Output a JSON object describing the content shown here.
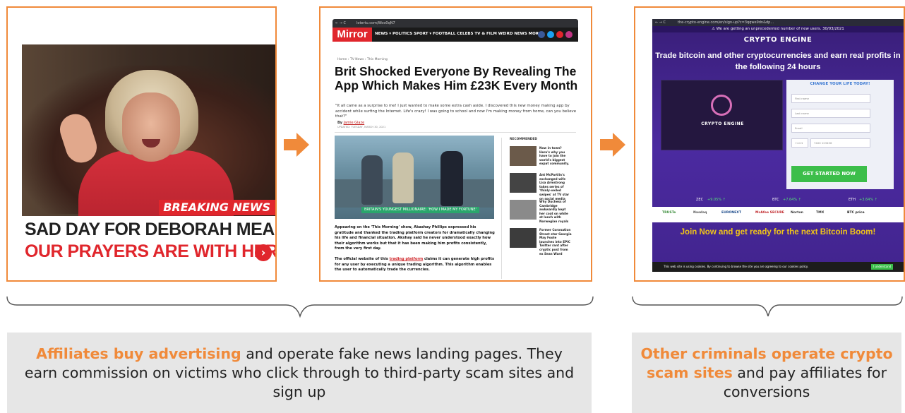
{
  "panel1": {
    "breaking": "BREAKING NEWS",
    "headline1": "SAD DAY FOR DEBORAH MEADEN",
    "headline2": "OUR PRAYERS ARE WITH HER"
  },
  "panel2": {
    "url": "lotertu.com/Woo0qN7",
    "logo": "Mirror",
    "nav": "NEWS ▾  POLITICS  SPORT ▾  FOOTBALL  CELEBS  TV & FILM  WEIRD NEWS  MORE ▾",
    "breadcrumb": "Home  ›  TV News  ›  This Morning",
    "headline": "Brit Shocked Everyone By Revealing The App Which Makes Him £23K Every Month",
    "intro": "\"It all came as a surprise to me! I just wanted to make some extra cash aside. I discovered this new money making app by accident while surfing the Internet. Life's crazy! I was going to school and now I'm making money from home, can you believe that?\"",
    "by": "By",
    "author": "Jamie Glaze",
    "updated": "UPDATED: TUESDAY, MARCH 30, 2021",
    "image_caption": "BRITAIN'S YOUNGEST MILLIONAIRE: 'HOW I MADE MY FORTUNE'",
    "para1": "Appearing on the 'This Morning' show, Akashay Phillips expressed his gratitude and thanked the trading platform creators for dramatically changing his life and financial situation. Akshay said he never understood exactly how their algorithm works but that it has been making him profits consistently, from the very first day.",
    "para2_before": "The official website of this",
    "para2_link": "trading platform",
    "para2_after": "claims it can generate high profits for any user by executing a unique trading algorithm. This algorithm enables the user to automatically trade the currencies.",
    "recommended": "RECOMMENDED",
    "rec_items": [
      "Now in town? Here's why you have to join the world's biggest expat community.",
      "Ant McPartlin's exchanged wife Lisa Armstrong takes series of 'thinly-veiled swipes' at TV star on social media",
      "Why Duchess of Cambridge awkwardly kept her coat on while at lunch with Norwegian royals",
      "Former Coronation Street star Georgia May Foote launches into EPIC Twitter rant after cryptic post from ex Sean Ward"
    ]
  },
  "panel3": {
    "url": "the-crypto-engine.com/en/sign-up?c=3qqwe9dn&dp...",
    "warning": "⚠ We are getting an unprecedented number of new users. 30/03/2021",
    "brand": "CRYPTO ENGINE",
    "title": "Trade bitcoin and other cryptocurrencies and earn real profits in the following 24 hours",
    "video_logo": "CRYPTO ENGINE",
    "form_header": "CHANGE YOUR LIFE TODAY!",
    "first_name": "First name",
    "last_name": "Last name",
    "email": "Email",
    "phone_prefix": "+44 ▾",
    "phone": "7400 123456",
    "cta": "GET STARTED NOW",
    "tickers": [
      {
        "label": "ZEC",
        "value": "+9.05% ↑"
      },
      {
        "label": "BTC",
        "value": "+7.64% ↑"
      },
      {
        "label": "ETH",
        "value": "+3.64% ↑"
      }
    ],
    "partners": [
      "TRUSTe",
      "Nasdaq",
      "EURONEXT",
      "McAfee SECURE",
      "Norton",
      "TMX"
    ],
    "btc_price": "BTC price",
    "join": "Join Now and get ready for the next Bitcoin Boom!",
    "cookie": "This web site is using cookies. By continuing to browse the site you are agreeing to our cookies policy.",
    "cookie_ok": "I understand"
  },
  "caption_left": {
    "highlight": "Affiliates buy advertising",
    "rest": " and operate fake news landing pages. They earn commission on victims who click through to third-party scam sites and sign up"
  },
  "caption_right": {
    "highlight": "Other criminals operate crypto scam sites",
    "rest": " and pay affiliates for conversions"
  },
  "colors": {
    "accent": "#f08a3a",
    "caption_bg": "#e6e6e6",
    "mirror_red": "#e0262c",
    "crypto_purple": "#4b2aa0"
  }
}
